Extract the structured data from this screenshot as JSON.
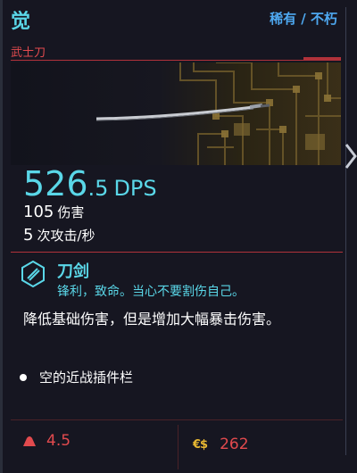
{
  "item": {
    "name": "觉",
    "rarity": "稀有 / 不朽",
    "type": "武士刀"
  },
  "stats": {
    "dps_integer": "526",
    "dps_decimal": ".5",
    "dps_label": "DPS",
    "damage_value": "105",
    "damage_label": "伤害",
    "attacks_value": "5",
    "attacks_label": "次攻击/秒"
  },
  "perk": {
    "icon": "blade-perk-icon",
    "name": "刀剑",
    "description": "锋利，致命。当心不要割伤自己。"
  },
  "effect": {
    "text": "降低基础伤害，但是增加大幅暴击伤害。"
  },
  "mod_slot": {
    "label": "空的近战插件栏"
  },
  "footer": {
    "weight_icon": "weight-icon",
    "weight": "4.5",
    "currency_symbol": "€$",
    "price": "262"
  },
  "colors": {
    "cyan": "#5ad7e8",
    "red": "#e24a4e",
    "blue": "#4ea8f0",
    "gold": "#e8b832",
    "background": "#161621"
  }
}
